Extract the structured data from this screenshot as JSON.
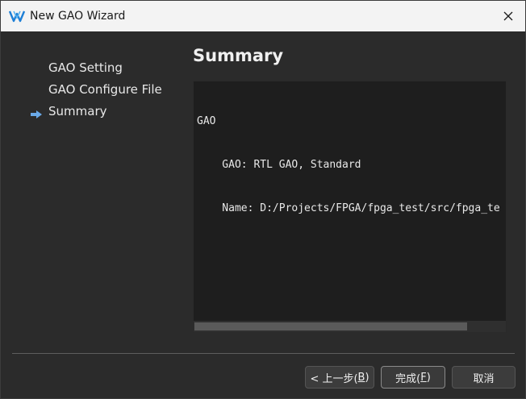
{
  "window": {
    "title": "New GAO Wizard",
    "app_icon": "gowin-logo-icon",
    "close_icon": "close-icon"
  },
  "nav": {
    "items": [
      {
        "label": "GAO Setting",
        "active": false
      },
      {
        "label": "GAO Configure File",
        "active": false
      },
      {
        "label": "Summary",
        "active": true
      }
    ],
    "active_marker_icon": "arrow-right-icon",
    "accent_color": "#6aa9e8"
  },
  "page": {
    "heading": "Summary",
    "summary_lines": [
      "GAO",
      "    GAO: RTL GAO, Standard",
      "    Name: D:/Projects/FPGA/fpga_test/src/fpga_te"
    ]
  },
  "buttons": {
    "back": {
      "pre": "< 上一步(",
      "mnemonic": "B",
      "post": ")"
    },
    "finish": {
      "pre": "完成(",
      "mnemonic": "F",
      "post": ")"
    },
    "cancel": {
      "label": "取消"
    }
  }
}
